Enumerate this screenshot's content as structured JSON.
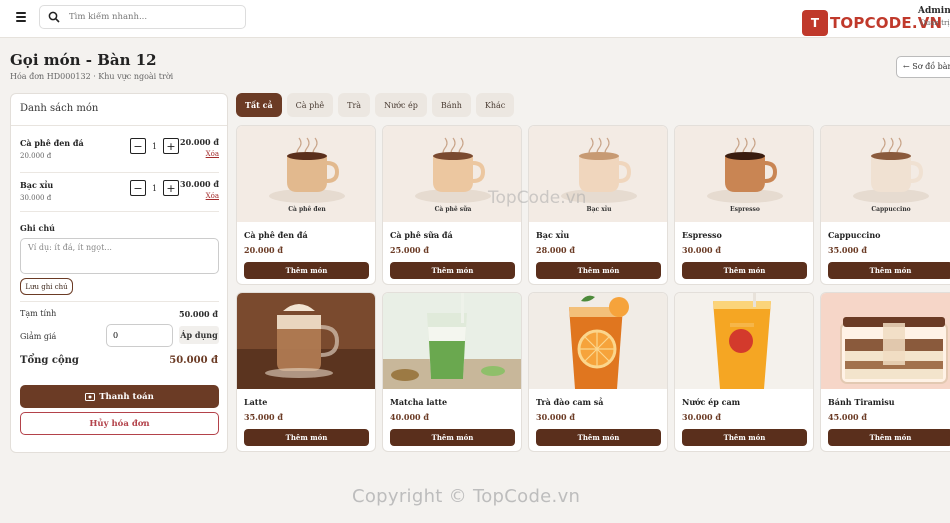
{
  "topbar": {
    "search_placeholder": "Tìm kiếm nhanh...",
    "logo_text": "TOPCODE.VN",
    "logo_mark": "T",
    "user_name": "Admin",
    "user_role": "Quản trị viên"
  },
  "header": {
    "title": "Gọi món - Bàn 12",
    "subtitle": "Hóa đơn HD000132 · Khu vực ngoài trời",
    "back_label": "Sơ đồ bàn"
  },
  "order": {
    "heading": "Danh sách món",
    "items": [
      {
        "name": "Cà phê đen đá",
        "unit_price": "20.000 đ",
        "qty": "1",
        "total": "20.000 đ",
        "remove": "Xóa"
      },
      {
        "name": "Bạc xỉu",
        "unit_price": "30.000 đ",
        "qty": "1",
        "total": "30.000 đ",
        "remove": "Xóa"
      }
    ],
    "note_label": "Ghi chú",
    "note_placeholder": "Ví dụ: ít đá, ít ngọt...",
    "save_note": "Lưu ghi chú",
    "subtotal_label": "Tạm tính",
    "subtotal": "50.000 đ",
    "discount_label": "Giảm giá",
    "discount_value": "0",
    "apply_label": "Áp dụng",
    "total_label": "Tổng cộng",
    "total": "50.000 đ",
    "pay_label": "Thanh toán",
    "cancel_label": "Hủy hóa đơn"
  },
  "categories": [
    "Tất cả",
    "Cà phê",
    "Trà",
    "Nước ép",
    "Bánh",
    "Khác"
  ],
  "active_category": 0,
  "add_label": "Thêm món",
  "products": [
    {
      "name": "Cà phê đen đá",
      "price": "20.000 đ",
      "caption": "Cà phê đen",
      "cup": "#e2b98e",
      "liquid": "#5a2f1c"
    },
    {
      "name": "Cà phê sữa đá",
      "price": "25.000 đ",
      "caption": "Cà phê sữa",
      "cup": "#ecc7a0",
      "liquid": "#7a4a30"
    },
    {
      "name": "Bạc xỉu",
      "price": "28.000 đ",
      "caption": "Bạc xỉu",
      "cup": "#f0d6bd",
      "liquid": "#c79a73"
    },
    {
      "name": "Espresso",
      "price": "30.000 đ",
      "caption": "Espresso",
      "cup": "#c98553",
      "liquid": "#3a1d10"
    },
    {
      "name": "Cappuccino",
      "price": "35.000 đ",
      "caption": "Cappuccino",
      "cup": "#f0e1d2",
      "liquid": "#8a5a3c"
    },
    {
      "name": "Latte",
      "price": "35.000 đ",
      "photo": "latte"
    },
    {
      "name": "Matcha latte",
      "price": "40.000 đ",
      "photo": "matcha"
    },
    {
      "name": "Trà đào cam sả",
      "price": "30.000 đ",
      "photo": "peach"
    },
    {
      "name": "Nước ép cam",
      "price": "30.000 đ",
      "photo": "orange"
    },
    {
      "name": "Bánh Tiramisu",
      "price": "45.000 đ",
      "photo": "tiramisu"
    }
  ],
  "watermark": "Copyright © TopCode.vn",
  "watermark_center": "TopCode.vn",
  "colors": {
    "brand": "#6b3b25",
    "danger": "#b3424a",
    "logo": "#c0392b"
  }
}
